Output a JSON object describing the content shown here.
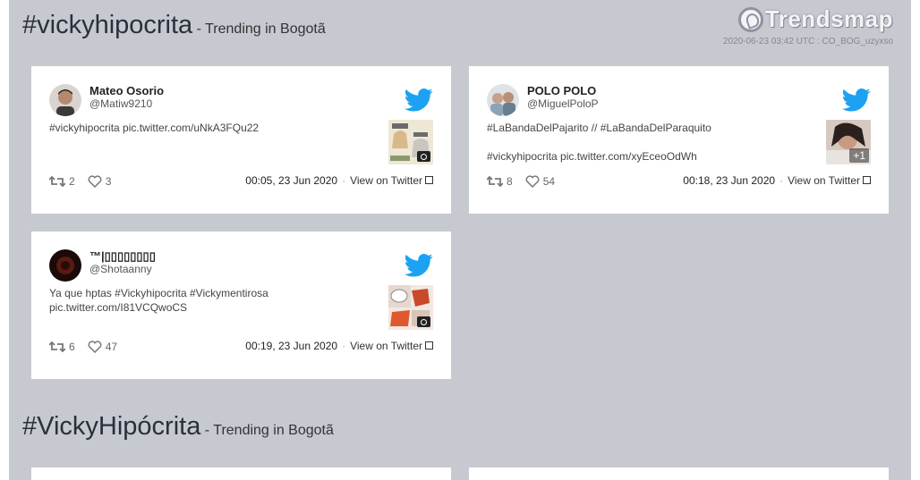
{
  "section1": {
    "hashtag": "#vickyhipocrita",
    "subtitle": "- Trending in Bogotã"
  },
  "section2": {
    "hashtag": "#VickyHipócrita",
    "subtitle": "- Trending in Bogotã"
  },
  "brand": {
    "logo": "Trendsmap",
    "stamp": "2020-06-23 03:42 UTC : CO_BOG_uzyxso"
  },
  "tweets": [
    {
      "name": "Mateo Osorio",
      "handle": "@Matiw9210",
      "line1": "#vickyhipocrita pic.twitter.com/uNkA3FQu22",
      "line2": "",
      "line3": "",
      "retweets": "2",
      "likes": "3",
      "time": "00:05, 23 Jun 2020",
      "view": "View on Twitter",
      "extra_media": ""
    },
    {
      "name": "POLO POLO",
      "handle": "@MiguelPoloP",
      "line1": "#LaBandaDelPajarito // #LaBandaDelParaquito",
      "line2": "",
      "line3": "#vickyhipocrita pic.twitter.com/xyEceoOdWh",
      "retweets": "8",
      "likes": "54",
      "time": "00:18, 23 Jun 2020",
      "view": "View on Twitter",
      "extra_media": "+1"
    },
    {
      "name": "™|▯▯▯▯▯▯▯▯",
      "handle": "@Shotaanny",
      "line1": "Ya que hptas #Vickyhipocrita #Vickymentirosa",
      "line2": "pic.twitter.com/I81VCQwoCS",
      "line3": "",
      "retweets": "6",
      "likes": "47",
      "time": "00:19, 23 Jun 2020",
      "view": "View on Twitter",
      "extra_media": ""
    }
  ],
  "colors": {
    "background": "#c7c9d1",
    "card": "#ffffff",
    "twitter_blue": "#1da1f2"
  },
  "icons": [
    "trendsmap-logo-icon",
    "twitter-bird-icon",
    "retweet-icon",
    "heart-icon",
    "external-link-icon",
    "camera-icon"
  ]
}
